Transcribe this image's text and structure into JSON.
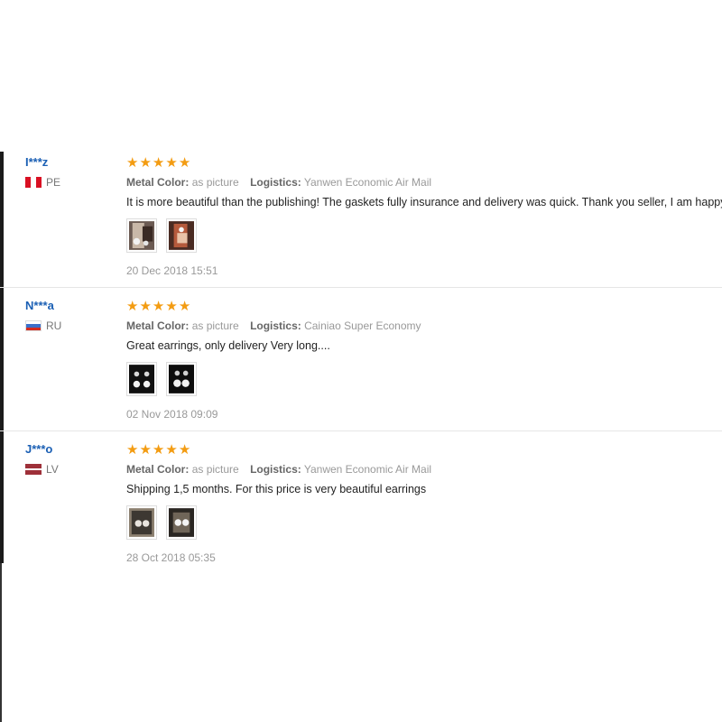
{
  "labels": {
    "metal_color": "Metal Color:",
    "logistics": "Logistics:"
  },
  "colors": {
    "username": "#1a5fb4",
    "stars": "#f39c12",
    "meta_text": "#999999",
    "review_text": "#222222"
  },
  "reviews": [
    {
      "user": "I***z",
      "country": "PE",
      "flag_icon": "peru-flag-icon",
      "stars": 5,
      "metal_color": "as picture",
      "logistics": "Yanwen Economic Air Mail",
      "text": "It is more beautiful than the publishing! The gaskets fully insurance and delivery was quick. Thank you seller, I am happy",
      "photos": [
        "photo-icon",
        "photo-icon"
      ],
      "date": "20 Dec 2018 15:51"
    },
    {
      "user": "N***a",
      "country": "RU",
      "flag_icon": "russia-flag-icon",
      "stars": 5,
      "metal_color": "as picture",
      "logistics": "Cainiao Super Economy",
      "text": "Great earrings, only delivery Very long....",
      "photos": [
        "photo-icon",
        "photo-icon"
      ],
      "date": "02 Nov 2018 09:09"
    },
    {
      "user": "J***o",
      "country": "LV",
      "flag_icon": "latvia-flag-icon",
      "stars": 5,
      "metal_color": "as picture",
      "logistics": "Yanwen Economic Air Mail",
      "text": "Shipping 1,5 months. For this price is very beautiful earrings",
      "photos": [
        "photo-icon",
        "photo-icon"
      ],
      "date": "28 Oct 2018 05:35"
    }
  ]
}
